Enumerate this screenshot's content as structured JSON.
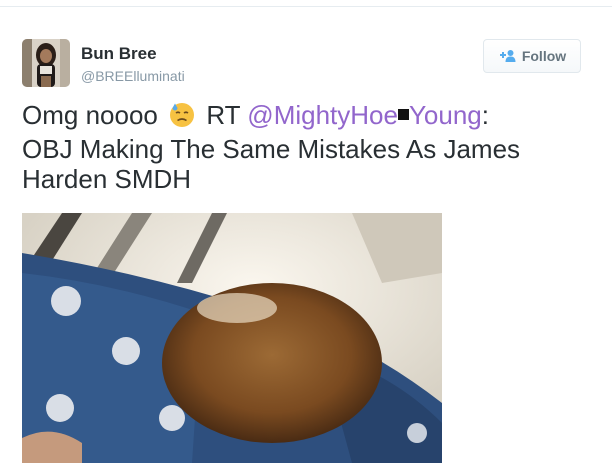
{
  "author": {
    "name": "Bun Bree",
    "handle": "@BREElluminati"
  },
  "follow": {
    "label": "Follow"
  },
  "tweet": {
    "text_start": "Omg noooo",
    "text_rt": "RT",
    "mention_part1": "@MightyHoe",
    "mention_part2": "Young",
    "text_after_mention": ":",
    "line2": "OBJ Making The Same Mistakes As James",
    "line3": "Harden SMDH"
  },
  "icons": {
    "follow": "add-user-icon",
    "emoji": "sweat-face-emoji",
    "redaction": "redaction-box"
  },
  "colors": {
    "mention": "#9266cc",
    "text": "#292f33",
    "handle": "#8899a6",
    "follow_icon": "#55acee"
  }
}
